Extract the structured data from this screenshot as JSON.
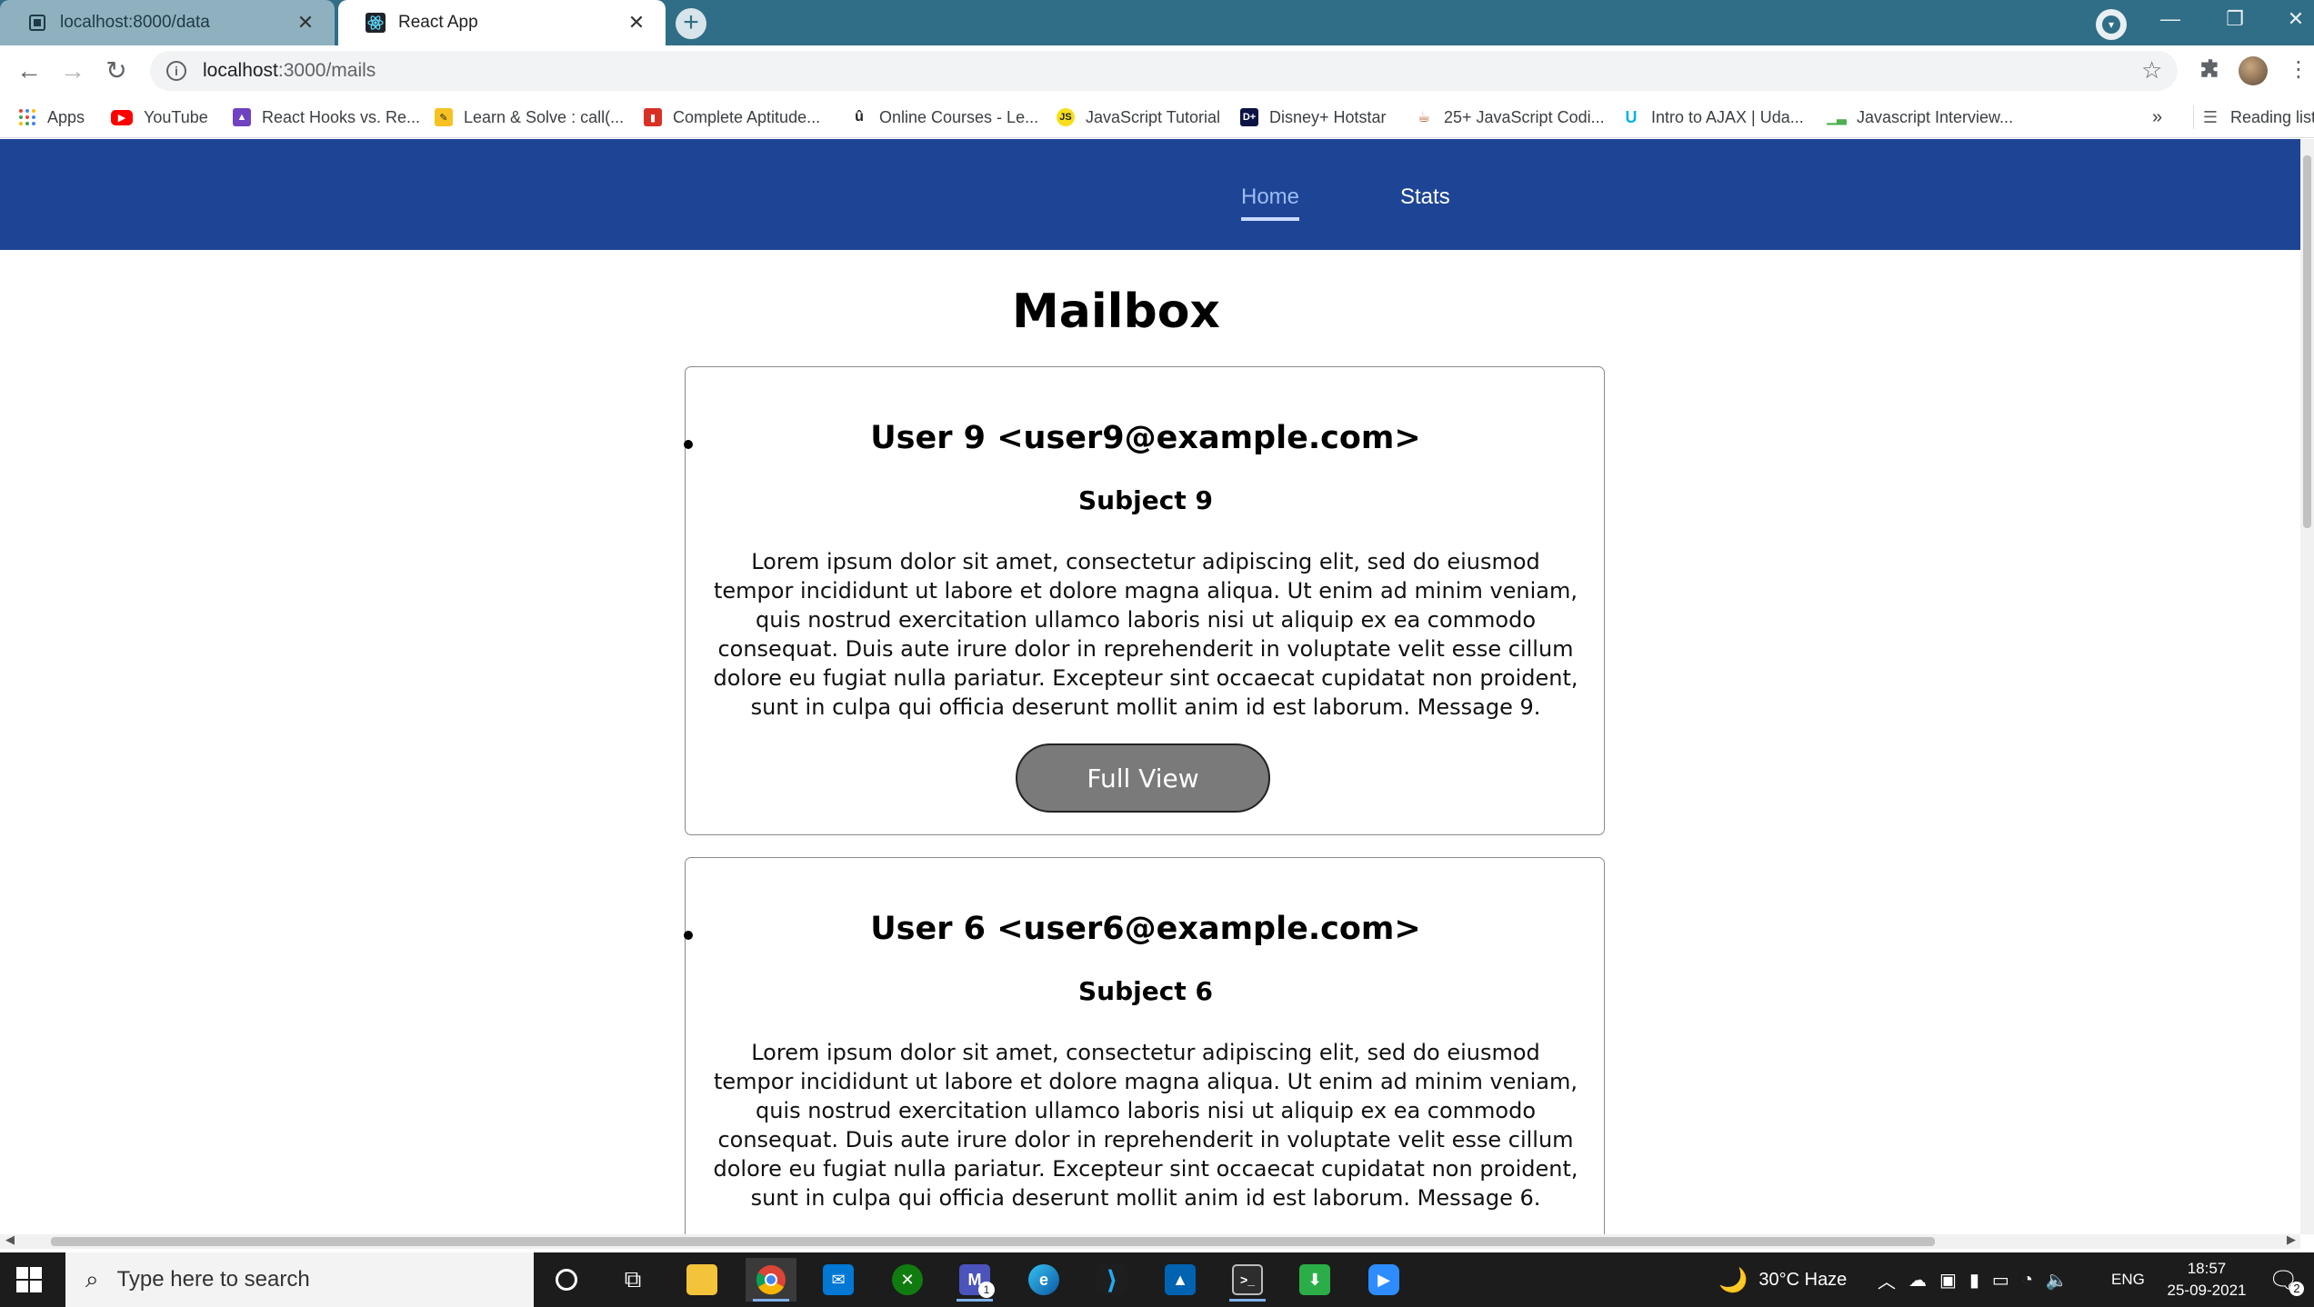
{
  "browser": {
    "tabs": [
      {
        "title": "localhost:8000/data",
        "active": false
      },
      {
        "title": "React App",
        "active": true
      }
    ],
    "new_tab_label": "+",
    "url_host": "localhost",
    "url_path": ":3000/mails",
    "bookmarks": [
      {
        "label": "Apps",
        "icon": "apps-grid-icon"
      },
      {
        "label": "YouTube",
        "icon": "youtube-icon"
      },
      {
        "label": "React Hooks vs. Re...",
        "icon": "rocket-icon"
      },
      {
        "label": "Learn & Solve : call(...",
        "icon": "pencil-icon"
      },
      {
        "label": "Complete Aptitude...",
        "icon": "book-icon"
      },
      {
        "label": "Online Courses - Le...",
        "icon": "udemy-icon"
      },
      {
        "label": "JavaScript Tutorial",
        "icon": "js-icon"
      },
      {
        "label": "Disney+ Hotstar",
        "icon": "hotstar-icon"
      },
      {
        "label": "25+ JavaScript Codi...",
        "icon": "cup-icon"
      },
      {
        "label": "Intro to AJAX | Uda...",
        "icon": "udacity-icon"
      },
      {
        "label": "Javascript Interview...",
        "icon": "chart-icon"
      }
    ],
    "bookmarks_overflow": "»",
    "reading_list": "Reading list"
  },
  "app": {
    "nav": {
      "home": "Home",
      "stats": "Stats",
      "active": "Home"
    },
    "title": "Mailbox",
    "mails": [
      {
        "from": "User 9 <user9@example.com>",
        "subject": "Subject 9",
        "body": "Lorem ipsum dolor sit amet, consectetur adipiscing elit, sed do eiusmod tempor incididunt ut labore et dolore magna aliqua. Ut enim ad minim veniam, quis nostrud exercitation ullamco laboris nisi ut aliquip ex ea commodo consequat. Duis aute irure dolor in reprehenderit in voluptate velit esse cillum dolore eu fugiat nulla pariatur. Excepteur sint occaecat cupidatat non proident, sunt in culpa qui officia deserunt mollit anim id est laborum. Message 9.",
        "button": "Full View"
      },
      {
        "from": "User 6 <user6@example.com>",
        "subject": "Subject 6",
        "body": "Lorem ipsum dolor sit amet, consectetur adipiscing elit, sed do eiusmod tempor incididunt ut labore et dolore magna aliqua. Ut enim ad minim veniam, quis nostrud exercitation ullamco laboris nisi ut aliquip ex ea commodo consequat. Duis aute irure dolor in reprehenderit in voluptate velit esse cillum dolore eu fugiat nulla pariatur. Excepteur sint occaecat cupidatat non proident, sunt in culpa qui officia deserunt mollit anim id est laborum. Message 6."
      }
    ]
  },
  "taskbar": {
    "search_placeholder": "Type here to search",
    "weather": "30°C  Haze",
    "language": "ENG",
    "time": "18:57",
    "date": "25-09-2021",
    "notification_count": "2",
    "mail_badge": "1"
  },
  "colors": {
    "navbar": "#1e4595",
    "browser_frame": "#306d86",
    "button": "#7a7a7a"
  }
}
